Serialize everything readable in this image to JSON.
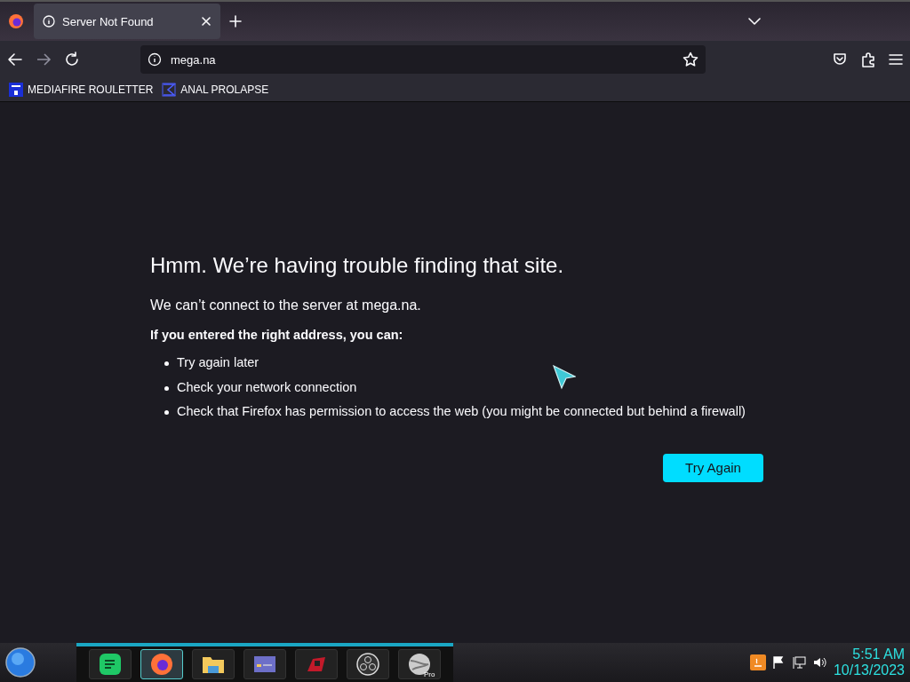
{
  "tabs": [
    {
      "title": "Server Not Found",
      "selected": true
    }
  ],
  "address_bar": {
    "url": "mega.na"
  },
  "bookmarks": [
    {
      "label": "MEDIAFIRE ROULETTER",
      "kind": "mediafire"
    },
    {
      "label": "ANAL PROLAPSE",
      "kind": "sigma"
    }
  ],
  "error_page": {
    "title": "Hmm. We’re having trouble finding that site.",
    "message": "We can’t connect to the server at mega.na.",
    "hint_heading": "If you entered the right address, you can:",
    "suggestions": [
      "Try again later",
      "Check your network connection",
      "Check that Firefox has permission to access the web (you might be connected but behind a firewall)"
    ],
    "button": "Try Again"
  },
  "taskbar": {
    "apps": [
      {
        "kind": "notes",
        "selected": false
      },
      {
        "kind": "firefox",
        "selected": true
      },
      {
        "kind": "folder",
        "selected": false
      },
      {
        "kind": "card",
        "selected": false
      },
      {
        "kind": "game",
        "selected": false
      },
      {
        "kind": "obs",
        "selected": false
      },
      {
        "kind": "globe",
        "selected": false,
        "badge": "Pro"
      }
    ],
    "time": "5:51 AM",
    "date": "10/13/2023"
  }
}
